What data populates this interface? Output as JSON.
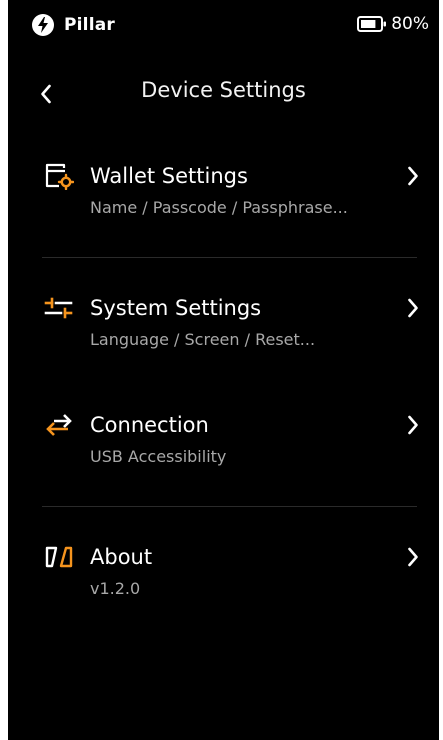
{
  "status_bar": {
    "device_name": "Pillar",
    "battery_percent": "80%",
    "battery_level": 0.8
  },
  "header": {
    "title": "Device Settings"
  },
  "menu": {
    "items": [
      {
        "title": "Wallet Settings",
        "subtitle": "Name / Passcode / Passphrase..."
      },
      {
        "title": "System Settings",
        "subtitle": "Language / Screen / Reset..."
      },
      {
        "title": "Connection",
        "subtitle": "USB Accessibility"
      },
      {
        "title": "About",
        "subtitle": "v1.2.0"
      }
    ]
  },
  "colors": {
    "background": "#000000",
    "accent": "#f5941e",
    "text_primary": "#ffffff",
    "text_secondary": "#a8a8a8",
    "divider": "#2a2a2a"
  },
  "icons": {
    "status": "bolt-icon",
    "battery": "battery-icon",
    "back": "chevron-left-icon",
    "wallet": "wallet-settings-icon",
    "system": "sliders-icon",
    "connection": "transfer-arrows-icon",
    "about": "pillar-logo-icon",
    "forward": "chevron-right-icon"
  }
}
